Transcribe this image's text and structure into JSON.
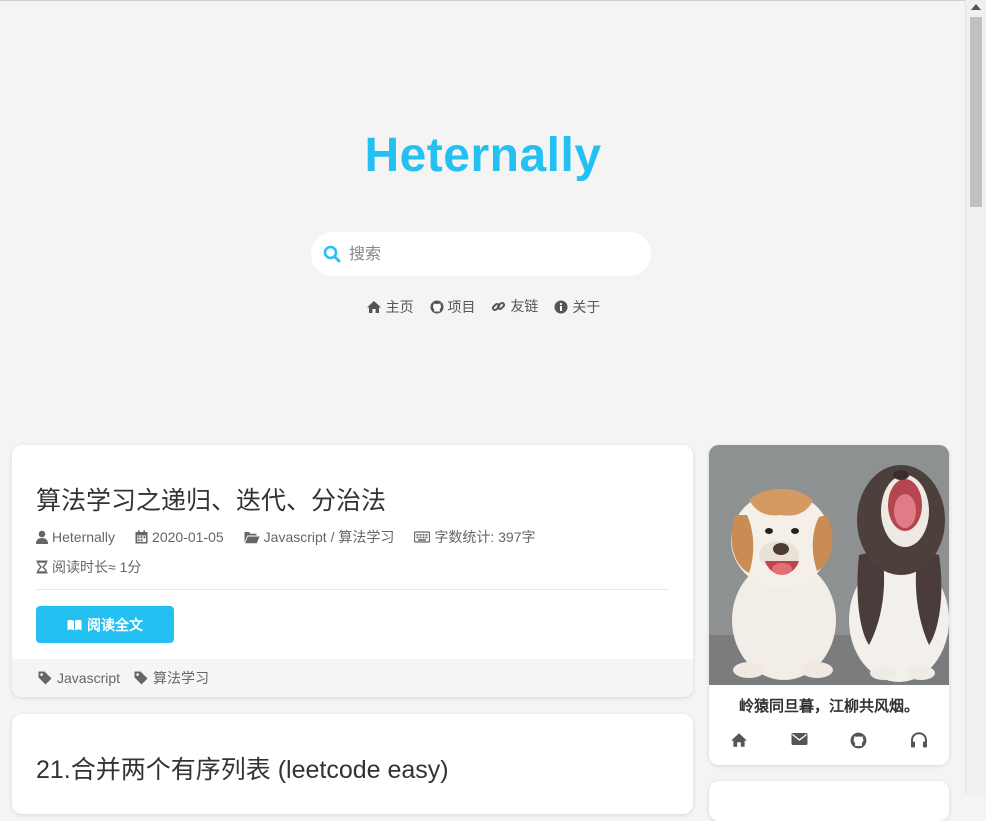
{
  "site": {
    "title": "Heternally"
  },
  "search": {
    "placeholder": "搜索"
  },
  "nav": {
    "items": [
      {
        "label": "主页",
        "icon": "home-icon"
      },
      {
        "label": "项目",
        "icon": "github-icon"
      },
      {
        "label": "友链",
        "icon": "link-icon"
      },
      {
        "label": "关于",
        "icon": "info-icon"
      }
    ]
  },
  "posts": [
    {
      "title": "算法学习之递归、迭代、分治法",
      "author": "Heternally",
      "date": "2020-01-05",
      "categories": "Javascript / 算法学习",
      "word_count": "字数统计: 397字",
      "read_time": "阅读时长≈ 1分",
      "read_more": "阅读全文",
      "tags": [
        "Javascript",
        "算法学习"
      ]
    },
    {
      "title": "21.合并两个有序列表 (leetcode easy)"
    }
  ],
  "profile": {
    "motto": "岭猿同旦暮，江柳共风烟。",
    "social": [
      "home-icon",
      "envelope-icon",
      "github-icon",
      "headphones-icon"
    ]
  },
  "colors": {
    "accent": "#24c0f1",
    "background": "#f4f4f4",
    "card": "#ffffff"
  }
}
